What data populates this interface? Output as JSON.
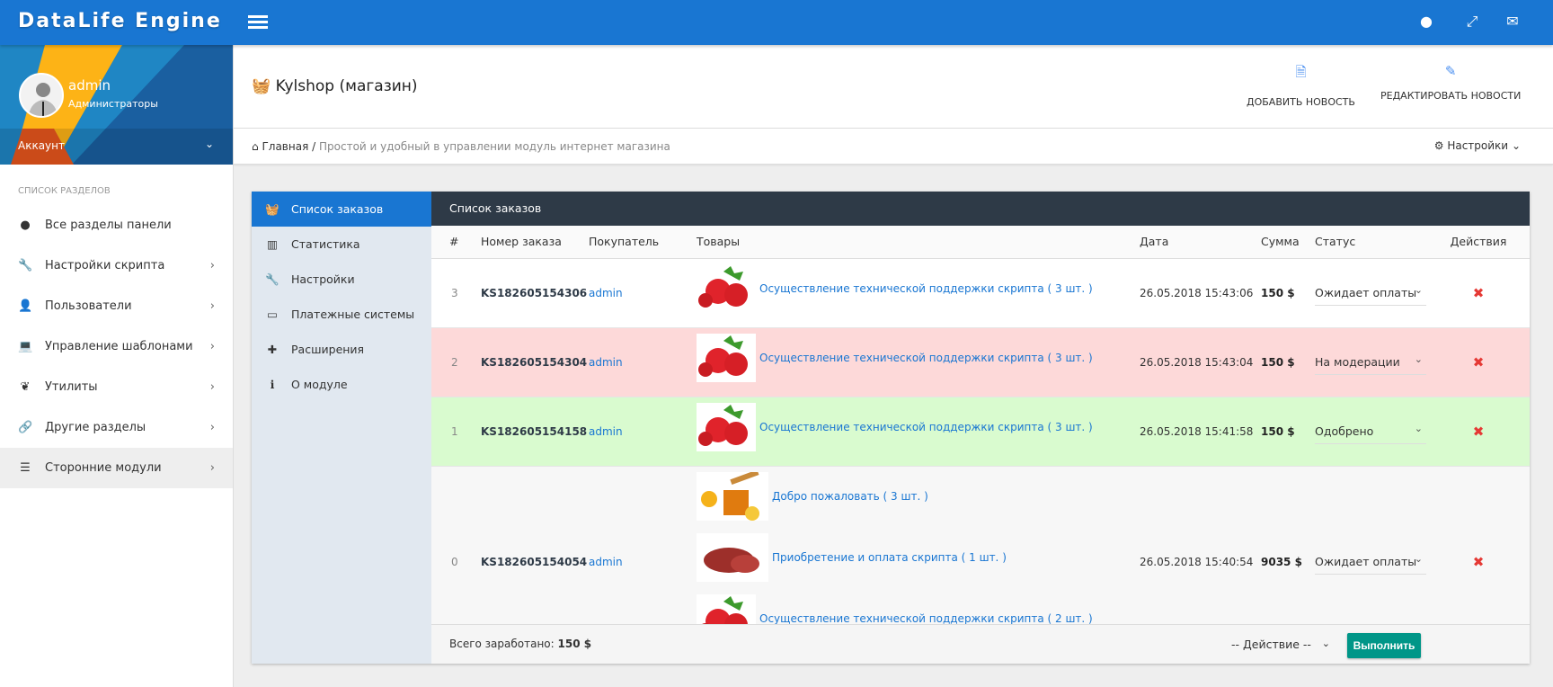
{
  "app": {
    "logo": "DataLife Engine"
  },
  "user": {
    "name": "admin",
    "role": "Администраторы",
    "account_label": "Аккаунт"
  },
  "sidebar": {
    "section_title": "Список разделов",
    "items": [
      {
        "label": "Все разделы панели",
        "icon": "globe-icon"
      },
      {
        "label": "Настройки скрипта",
        "icon": "wrench-icon"
      },
      {
        "label": "Пользователи",
        "icon": "user-icon"
      },
      {
        "label": "Управление шаблонами",
        "icon": "laptop-icon"
      },
      {
        "label": "Утилиты",
        "icon": "leaf-icon"
      },
      {
        "label": "Другие разделы",
        "icon": "link-icon"
      },
      {
        "label": "Сторонние модули",
        "icon": "list-icon"
      }
    ]
  },
  "header": {
    "title": "Kylshop (магазин)",
    "add_news": "ДОБАВИТЬ НОВОСТЬ",
    "edit_news": "РЕДАКТИРОВАТЬ НОВОСТИ"
  },
  "breadcrumb": {
    "home": "Главная",
    "sep": "/",
    "current": "Простой и удобный в управлении модуль интернет магазина",
    "settings": "Настройки"
  },
  "module_nav": [
    {
      "label": "Список заказов"
    },
    {
      "label": "Статистика"
    },
    {
      "label": "Настройки"
    },
    {
      "label": "Платежные системы"
    },
    {
      "label": "Расширения"
    },
    {
      "label": "О модуле"
    }
  ],
  "orders": {
    "title": "Список заказов",
    "columns": [
      "#",
      "Номер заказа",
      "Покупатель",
      "Товары",
      "Дата",
      "Сумма",
      "Статус",
      "Действия"
    ],
    "rows": [
      {
        "n": "3",
        "order": "KS182605154306",
        "buyer": "admin",
        "items": [
          {
            "name": "Осуществление технической поддержки скрипта ( 3 шт. )",
            "img": "strawberry"
          }
        ],
        "date": "26.05.2018 15:43:06",
        "sum": "150 $",
        "status": "Ожидает оплаты"
      },
      {
        "n": "2",
        "order": "KS182605154304",
        "buyer": "admin",
        "items": [
          {
            "name": "Осуществление технической поддержки скрипта ( 3 шт. )",
            "img": "strawberry"
          }
        ],
        "date": "26.05.2018 15:43:04",
        "sum": "150 $",
        "status": "На модерации"
      },
      {
        "n": "1",
        "order": "KS182605154158",
        "buyer": "admin",
        "items": [
          {
            "name": "Осуществление технической поддержки скрипта ( 3 шт. )",
            "img": "strawberry"
          }
        ],
        "date": "26.05.2018 15:41:58",
        "sum": "150 $",
        "status": "Одобрено"
      },
      {
        "n": "0",
        "order": "KS182605154054",
        "buyer": "admin",
        "items": [
          {
            "name": "Добро пожаловать ( 3 шт. )",
            "img": "honey"
          },
          {
            "name": "Приобретение и оплата скрипта ( 1 шт. )",
            "img": "meat"
          },
          {
            "name": "Осуществление технической поддержки скрипта ( 2 шт. )",
            "img": "strawberry"
          }
        ],
        "date": "26.05.2018 15:40:54",
        "sum": "9035 $",
        "status": "Ожидает оплаты"
      }
    ],
    "total_label": "Всего заработано:",
    "total_value": "150 $",
    "action_select": "-- Действие --",
    "run_button": "Выполнить"
  },
  "colors": {
    "topbar": "#1976d2",
    "table_header": "#2e3a47",
    "row_pending_moderation": "#fdd9d9",
    "row_approved": "#d9fbcf",
    "run_button": "#009688",
    "delete": "#e53935"
  }
}
